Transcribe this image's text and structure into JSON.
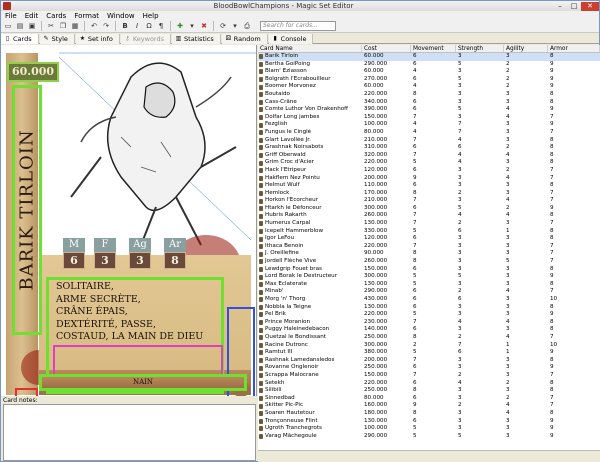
{
  "window": {
    "title": "BloodBowlChampions - Magic Set Editor",
    "min": "–",
    "max": "□",
    "close": "✕"
  },
  "menu": [
    "File",
    "Edit",
    "Cards",
    "Format",
    "Window",
    "Help"
  ],
  "toolbar": {
    "search_placeholder": "Search for cards..."
  },
  "tabs": [
    {
      "label": "Cards",
      "icon": "cards-icon"
    },
    {
      "label": "Style",
      "icon": "style-icon"
    },
    {
      "label": "Set info",
      "icon": "set-info-icon"
    },
    {
      "label": "Keywords",
      "icon": "keywords-icon"
    },
    {
      "label": "Statistics",
      "icon": "statistics-icon"
    },
    {
      "label": "Random",
      "icon": "random-icon"
    },
    {
      "label": "Console",
      "icon": "console-icon"
    }
  ],
  "card": {
    "price": "60.000",
    "name": "BARIK TIRLOIN",
    "stats": [
      {
        "label": "M",
        "value": "6"
      },
      {
        "label": "F",
        "value": "3"
      },
      {
        "label": "Ag",
        "value": "3"
      },
      {
        "label": "Ar",
        "value": "8"
      }
    ],
    "skills": [
      "SOLITAIRE,",
      "ARME SECRÈTE,",
      "CRÂNE ÉPAIS,",
      "DEXTÉRITÉ, PASSE,",
      "COSTAUD, LA MAIN DE DIEU"
    ],
    "race": "NAIN"
  },
  "notes_label": "Card notes:",
  "list": {
    "columns": [
      "Card Name",
      "Cost",
      "Movement",
      "Strength",
      "Agility",
      "Armor"
    ],
    "rows": [
      [
        "Barik Tirloin",
        "60.000",
        "6",
        "3",
        "3",
        "8"
      ],
      [
        "Bertha GoiPoing",
        "290.000",
        "6",
        "5",
        "2",
        "9"
      ],
      [
        "Blam' Eziasson",
        "60.000",
        "4",
        "3",
        "2",
        "9"
      ],
      [
        "Bolgrath l'Ecrabouilleur",
        "270.000",
        "6",
        "5",
        "2",
        "9"
      ],
      [
        "Boomer Morvonez",
        "60.000",
        "4",
        "3",
        "2",
        "9"
      ],
      [
        "Boutaido",
        "220.000",
        "8",
        "3",
        "3",
        "8"
      ],
      [
        "Cass-Crâne",
        "340.000",
        "6",
        "3",
        "3",
        "8"
      ],
      [
        "Comte Luthor Von Drakenhoff",
        "390.000",
        "6",
        "5",
        "4",
        "9"
      ],
      [
        "Dolfar Long jambes",
        "150.000",
        "7",
        "3",
        "4",
        "7"
      ],
      [
        "Fezglish",
        "100.000",
        "4",
        "7",
        "3",
        "9"
      ],
      [
        "Fungus le Cinglé",
        "80.000",
        "4",
        "7",
        "3",
        "7"
      ],
      [
        "Glart Lavollée Jr.",
        "210.000",
        "7",
        "4",
        "3",
        "8"
      ],
      [
        "Grashnak Noirsabots",
        "310.000",
        "6",
        "6",
        "2",
        "8"
      ],
      [
        "Griff Oberwald",
        "320.000",
        "7",
        "4",
        "4",
        "8"
      ],
      [
        "Grim Croc d'Acier",
        "220.000",
        "5",
        "4",
        "3",
        "8"
      ],
      [
        "Hack l'Étripeur",
        "120.000",
        "6",
        "3",
        "2",
        "7"
      ],
      [
        "Hakflem Nez Pointu",
        "200.000",
        "9",
        "3",
        "4",
        "7"
      ],
      [
        "Helmut Wulf",
        "110.000",
        "6",
        "3",
        "3",
        "8"
      ],
      [
        "Hemlock",
        "170.000",
        "8",
        "2",
        "3",
        "7"
      ],
      [
        "Horkon l'Écorcheur",
        "210.000",
        "7",
        "3",
        "4",
        "7"
      ],
      [
        "Htarkh le Défonceur",
        "300.000",
        "6",
        "5",
        "2",
        "9"
      ],
      [
        "Hubris Rakarth",
        "260.000",
        "7",
        "4",
        "4",
        "8"
      ],
      [
        "Humerus Carpal",
        "130.000",
        "7",
        "2",
        "3",
        "7"
      ],
      [
        "Icepelt Hammerblow",
        "330.000",
        "5",
        "6",
        "1",
        "8"
      ],
      [
        "Igor LeFou",
        "120.000",
        "6",
        "3",
        "3",
        "8"
      ],
      [
        "Ithaca Benoin",
        "220.000",
        "7",
        "3",
        "3",
        "7"
      ],
      [
        "J. Oreillefine",
        "90.000",
        "8",
        "3",
        "3",
        "7"
      ],
      [
        "Jordell Flèche Vive",
        "260.000",
        "8",
        "3",
        "5",
        "7"
      ],
      [
        "Lewdgrip Fouet bras",
        "150.000",
        "6",
        "3",
        "3",
        "8"
      ],
      [
        "Lord Borak le Destructeur",
        "300.000",
        "5",
        "5",
        "3",
        "9"
      ],
      [
        "Max Éclaterate",
        "130.000",
        "5",
        "3",
        "3",
        "8"
      ],
      [
        "Minab'",
        "290.000",
        "6",
        "2",
        "4",
        "7"
      ],
      [
        "Morg 'n' Thorg",
        "430.000",
        "6",
        "6",
        "3",
        "10"
      ],
      [
        "Nobbla la Teigne",
        "130.000",
        "6",
        "3",
        "3",
        "8"
      ],
      [
        "Pel Brik",
        "220.000",
        "5",
        "3",
        "3",
        "9"
      ],
      [
        "Prince Moranion",
        "230.000",
        "7",
        "4",
        "4",
        "8"
      ],
      [
        "Puggy Haleinedebacon",
        "140.000",
        "6",
        "3",
        "3",
        "8"
      ],
      [
        "Quetzal le Bondissant",
        "250.000",
        "8",
        "2",
        "4",
        "7"
      ],
      [
        "Racine Dutronc",
        "300.000",
        "2",
        "7",
        "1",
        "10"
      ],
      [
        "Ramtut III",
        "380.000",
        "5",
        "6",
        "1",
        "9"
      ],
      [
        "Rashnak Lamedansledos",
        "200.000",
        "7",
        "3",
        "3",
        "8"
      ],
      [
        "Rovanne Onglenoir",
        "250.000",
        "6",
        "3",
        "3",
        "9"
      ],
      [
        "Scrappa Malocrane",
        "150.000",
        "7",
        "2",
        "3",
        "7"
      ],
      [
        "Setekh",
        "220.000",
        "6",
        "4",
        "2",
        "8"
      ],
      [
        "Silibili",
        "250.000",
        "8",
        "3",
        "3",
        "8"
      ],
      [
        "Sinnedbad",
        "80.000",
        "6",
        "3",
        "2",
        "7"
      ],
      [
        "Skitter Pic-Pic",
        "160.000",
        "9",
        "2",
        "4",
        "7"
      ],
      [
        "Soaren Hautetour",
        "180.000",
        "8",
        "3",
        "4",
        "8"
      ],
      [
        "Tronçonneuse Flint",
        "130.000",
        "6",
        "3",
        "3",
        "9"
      ],
      [
        "Ugroth Tranchegrots",
        "100.000",
        "5",
        "3",
        "3",
        "9"
      ],
      [
        "Varag Mâchegoule",
        "290.000",
        "5",
        "5",
        "3",
        "9"
      ]
    ]
  },
  "colors": {
    "frame_green": "#6fe030",
    "notes_pink": "#e040c0",
    "corner_blue": "#3050e0",
    "corner_red": "#e03030"
  }
}
